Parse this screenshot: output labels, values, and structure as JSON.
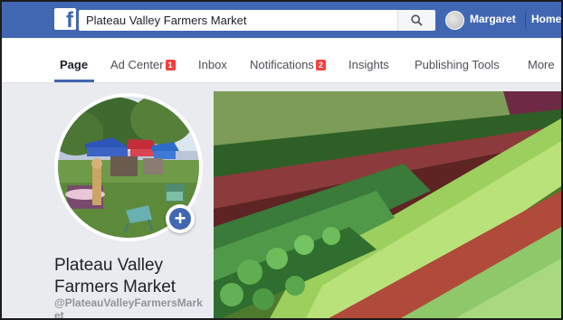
{
  "topbar": {
    "logo_letter": "f",
    "search_value": "Plateau Valley Farmers Market",
    "user_name": "Margaret",
    "home_label": "Home"
  },
  "tabs": [
    {
      "label": "Page",
      "active": true
    },
    {
      "label": "Ad Center",
      "badge": "1"
    },
    {
      "label": "Inbox"
    },
    {
      "label": "Notifications",
      "badge": "2"
    },
    {
      "label": "Insights"
    },
    {
      "label": "Publishing Tools"
    },
    {
      "label": "More"
    }
  ],
  "profile": {
    "add_symbol": "+",
    "name": "Plateau Valley Farmers Market",
    "handle": "@PlateauValleyFarmersMarket"
  },
  "colors": {
    "brand_blue": "#4267b2",
    "badge_red": "#fa3e3e",
    "background": "#e9ebee"
  },
  "icons": [
    "facebook-logo-icon",
    "search-icon",
    "add-icon"
  ]
}
